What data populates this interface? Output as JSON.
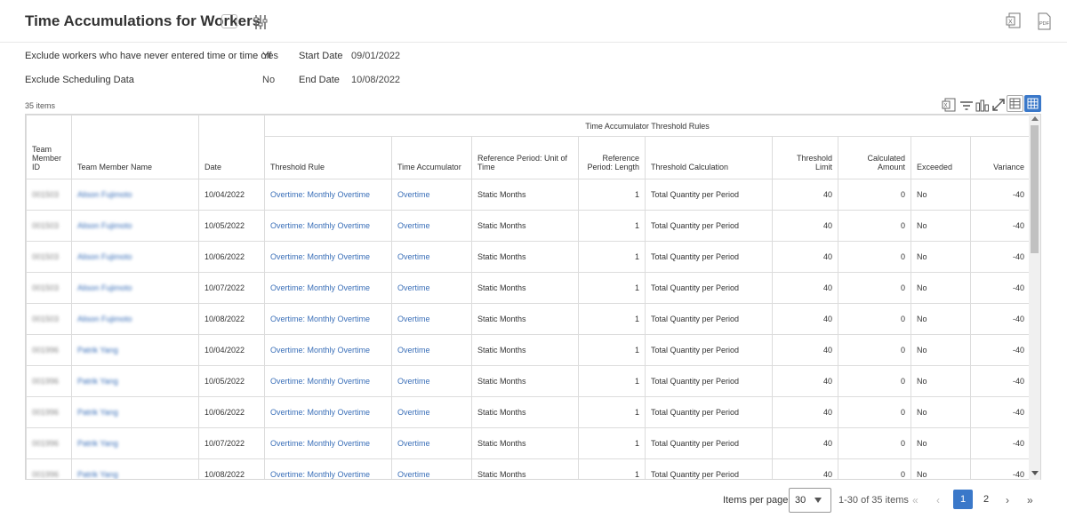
{
  "header": {
    "title": "Time Accumulations for Workers",
    "more_label": "···"
  },
  "filters": {
    "exclude_workers_label": "Exclude workers who have never entered time or time off",
    "exclude_workers_value": "Yes",
    "exclude_scheduling_label": "Exclude Scheduling Data",
    "exclude_scheduling_value": "No",
    "start_date_label": "Start Date",
    "start_date_value": "09/01/2022",
    "end_date_label": "End Date",
    "end_date_value": "10/08/2022"
  },
  "items_count": "35 items",
  "grid": {
    "group_header": "Time Accumulator Threshold Rules",
    "columns": [
      "Team Member ID",
      "Team Member Name",
      "Date",
      "Threshold Rule",
      "Time Accumulator",
      "Reference Period: Unit of Time",
      "Reference Period: Length",
      "Threshold Calculation",
      "Threshold Limit",
      "Calculated Amount",
      "Exceeded",
      "Variance"
    ],
    "rows": [
      {
        "id": "001503",
        "name": "Alison Fujimoto",
        "date": "10/04/2022",
        "rule": "Overtime: Monthly Overtime",
        "accumulator": "Overtime",
        "unit": "Static Months",
        "length": "1",
        "calc": "Total Quantity per Period",
        "limit": "40",
        "amount": "0",
        "exceeded": "No",
        "variance": "-40"
      },
      {
        "id": "001503",
        "name": "Alison Fujimoto",
        "date": "10/05/2022",
        "rule": "Overtime: Monthly Overtime",
        "accumulator": "Overtime",
        "unit": "Static Months",
        "length": "1",
        "calc": "Total Quantity per Period",
        "limit": "40",
        "amount": "0",
        "exceeded": "No",
        "variance": "-40"
      },
      {
        "id": "001503",
        "name": "Alison Fujimoto",
        "date": "10/06/2022",
        "rule": "Overtime: Monthly Overtime",
        "accumulator": "Overtime",
        "unit": "Static Months",
        "length": "1",
        "calc": "Total Quantity per Period",
        "limit": "40",
        "amount": "0",
        "exceeded": "No",
        "variance": "-40"
      },
      {
        "id": "001503",
        "name": "Alison Fujimoto",
        "date": "10/07/2022",
        "rule": "Overtime: Monthly Overtime",
        "accumulator": "Overtime",
        "unit": "Static Months",
        "length": "1",
        "calc": "Total Quantity per Period",
        "limit": "40",
        "amount": "0",
        "exceeded": "No",
        "variance": "-40"
      },
      {
        "id": "001503",
        "name": "Alison Fujimoto",
        "date": "10/08/2022",
        "rule": "Overtime: Monthly Overtime",
        "accumulator": "Overtime",
        "unit": "Static Months",
        "length": "1",
        "calc": "Total Quantity per Period",
        "limit": "40",
        "amount": "0",
        "exceeded": "No",
        "variance": "-40"
      },
      {
        "id": "001996",
        "name": "Patrik Yang",
        "date": "10/04/2022",
        "rule": "Overtime: Monthly Overtime",
        "accumulator": "Overtime",
        "unit": "Static Months",
        "length": "1",
        "calc": "Total Quantity per Period",
        "limit": "40",
        "amount": "0",
        "exceeded": "No",
        "variance": "-40"
      },
      {
        "id": "001996",
        "name": "Patrik Yang",
        "date": "10/05/2022",
        "rule": "Overtime: Monthly Overtime",
        "accumulator": "Overtime",
        "unit": "Static Months",
        "length": "1",
        "calc": "Total Quantity per Period",
        "limit": "40",
        "amount": "0",
        "exceeded": "No",
        "variance": "-40"
      },
      {
        "id": "001996",
        "name": "Patrik Yang",
        "date": "10/06/2022",
        "rule": "Overtime: Monthly Overtime",
        "accumulator": "Overtime",
        "unit": "Static Months",
        "length": "1",
        "calc": "Total Quantity per Period",
        "limit": "40",
        "amount": "0",
        "exceeded": "No",
        "variance": "-40"
      },
      {
        "id": "001996",
        "name": "Patrik Yang",
        "date": "10/07/2022",
        "rule": "Overtime: Monthly Overtime",
        "accumulator": "Overtime",
        "unit": "Static Months",
        "length": "1",
        "calc": "Total Quantity per Period",
        "limit": "40",
        "amount": "0",
        "exceeded": "No",
        "variance": "-40"
      },
      {
        "id": "001996",
        "name": "Patrik Yang",
        "date": "10/08/2022",
        "rule": "Overtime: Monthly Overtime",
        "accumulator": "Overtime",
        "unit": "Static Months",
        "length": "1",
        "calc": "Total Quantity per Period",
        "limit": "40",
        "amount": "0",
        "exceeded": "No",
        "variance": "-40"
      }
    ]
  },
  "pager": {
    "items_per_page_label": "Items per page",
    "items_per_page_value": "30",
    "range_text": "1-30 of 35 items",
    "pages": [
      "1",
      "2"
    ],
    "current_page": "1"
  },
  "icons": {
    "more": "ellipsis-icon",
    "tune": "tune-icon",
    "excel": "excel-export-icon",
    "pdf": "pdf-export-icon",
    "filter": "filter-icon",
    "columns": "columns-icon",
    "fullscreen": "fullscreen-icon",
    "table_view": "table-view-icon",
    "grid_view": "grid-view-icon"
  },
  "colors": {
    "accent": "#3a78c9",
    "link": "#3a6fb8"
  }
}
